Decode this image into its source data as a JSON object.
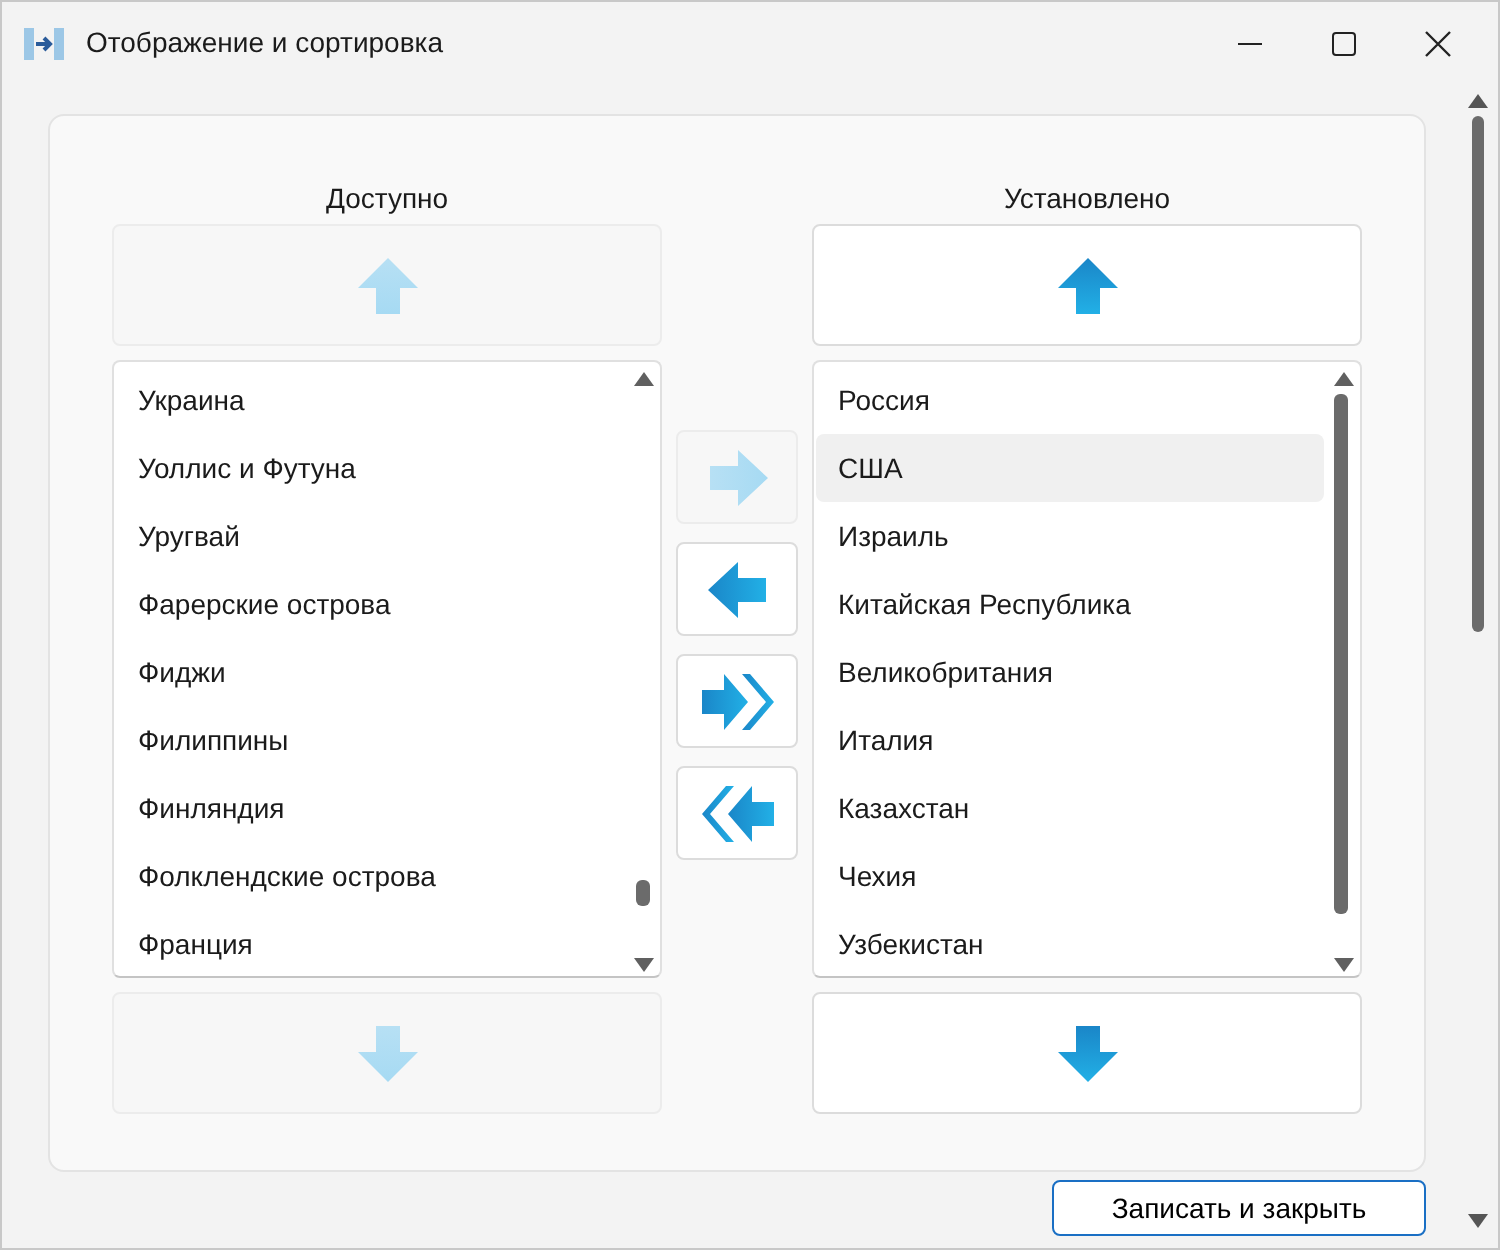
{
  "window": {
    "title": "Отображение и сортировка"
  },
  "available": {
    "header": "Доступно",
    "up_button": {
      "kind": "up",
      "disabled": true
    },
    "down_button": {
      "kind": "down",
      "disabled": true
    },
    "items": [
      {
        "label": "Украина",
        "selected": false
      },
      {
        "label": "Уоллис и Футуна",
        "selected": false
      },
      {
        "label": "Уругвай",
        "selected": false
      },
      {
        "label": "Фарерские острова",
        "selected": false
      },
      {
        "label": "Фиджи",
        "selected": false
      },
      {
        "label": "Филиппины",
        "selected": false
      },
      {
        "label": "Финляндия",
        "selected": false
      },
      {
        "label": "Фолклендские острова",
        "selected": false
      },
      {
        "label": "Франция",
        "selected": false
      }
    ]
  },
  "transfer_buttons": [
    {
      "kind": "right",
      "disabled": true
    },
    {
      "kind": "left",
      "disabled": false
    },
    {
      "kind": "right-all",
      "disabled": false
    },
    {
      "kind": "left-all",
      "disabled": false
    }
  ],
  "installed": {
    "header": "Установлено",
    "up_button": {
      "kind": "up",
      "disabled": false
    },
    "down_button": {
      "kind": "down",
      "disabled": false
    },
    "items": [
      {
        "label": "Россия",
        "selected": false
      },
      {
        "label": "США",
        "selected": true
      },
      {
        "label": "Израиль",
        "selected": false
      },
      {
        "label": "Китайская Республика",
        "selected": false
      },
      {
        "label": "Великобритания",
        "selected": false
      },
      {
        "label": "Италия",
        "selected": false
      },
      {
        "label": "Казахстан",
        "selected": false
      },
      {
        "label": "Чехия",
        "selected": false
      },
      {
        "label": "Узбекистан",
        "selected": false
      }
    ]
  },
  "save_button": {
    "label": "Записать и закрыть"
  }
}
